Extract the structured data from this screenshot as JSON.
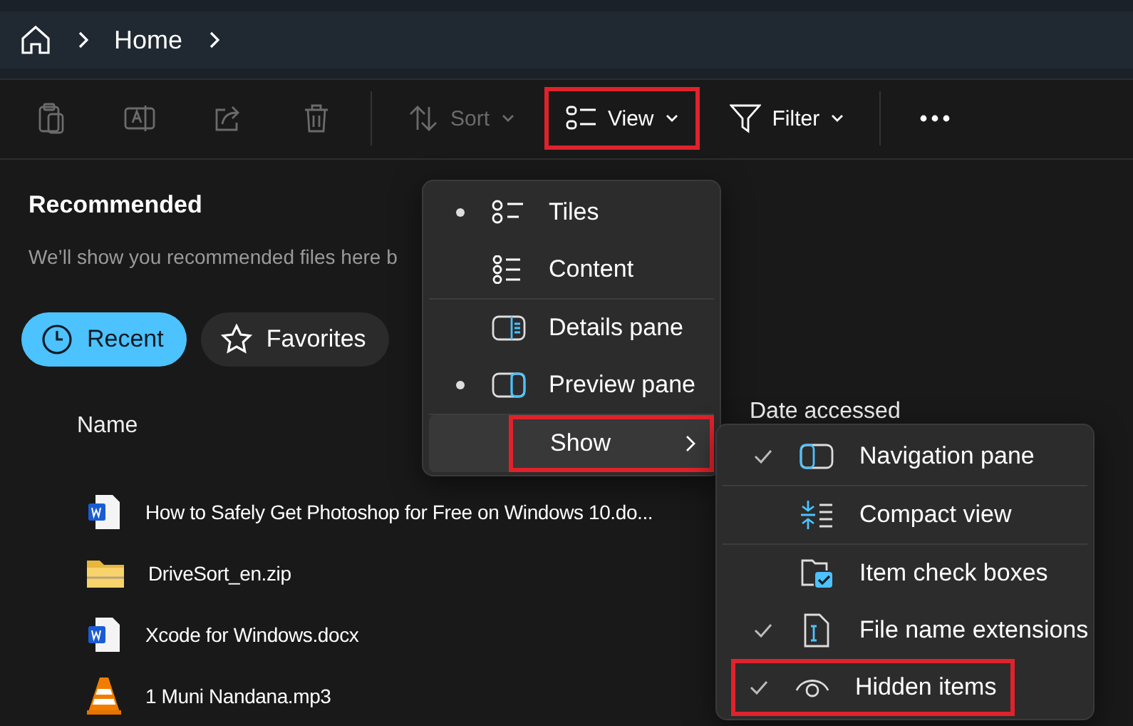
{
  "breadcrumb": {
    "items": [
      "Home"
    ]
  },
  "toolbar": [
    {
      "kind": "paste",
      "disabled": true
    },
    {
      "kind": "rename",
      "disabled": true
    },
    {
      "kind": "share",
      "disabled": true
    },
    {
      "kind": "delete",
      "disabled": true
    },
    {
      "kind": "sort",
      "label": "Sort",
      "disabled": true,
      "highlighted": false
    },
    {
      "kind": "view",
      "label": "View",
      "disabled": false,
      "highlighted": true
    },
    {
      "kind": "filter",
      "label": "Filter",
      "disabled": false,
      "highlighted": false
    },
    {
      "kind": "more"
    }
  ],
  "recommended": {
    "title": "Recommended",
    "message": "We’ll show you recommended files here b"
  },
  "chips": [
    {
      "kind": "recent",
      "label": "Recent",
      "selected": true
    },
    {
      "kind": "favorites",
      "label": "Favorites",
      "selected": false
    }
  ],
  "columns": [
    "Name",
    "Date accessed"
  ],
  "files": [
    {
      "kind": "word",
      "name": "How to Safely Get Photoshop for Free on Windows 10.do..."
    },
    {
      "kind": "zip",
      "name": "DriveSort_en.zip"
    },
    {
      "kind": "word",
      "name": "Xcode for Windows.docx"
    },
    {
      "kind": "video",
      "name": "1 Muni Nandana.mp3"
    }
  ],
  "view_menu": [
    [
      {
        "kind": "option",
        "label": "Tiles",
        "checked": true
      },
      {
        "kind": "option",
        "label": "Content",
        "checked": false
      }
    ],
    [
      {
        "kind": "option",
        "label": "Details pane",
        "checked": false
      },
      {
        "kind": "option",
        "label": "Preview pane",
        "checked": true
      }
    ],
    [
      {
        "kind": "submenu",
        "label": "Show",
        "highlighted": true,
        "expanded": true
      }
    ]
  ],
  "show_menu": [
    [
      {
        "label": "Navigation pane",
        "checked": true,
        "highlighted": false
      }
    ],
    [
      {
        "label": "Compact view",
        "checked": false,
        "highlighted": false
      }
    ],
    [
      {
        "label": "Item check boxes",
        "checked": false,
        "highlighted": false
      },
      {
        "label": "File name extensions",
        "checked": true,
        "highlighted": false
      },
      {
        "label": "Hidden items",
        "checked": true,
        "highlighted": true
      }
    ]
  ]
}
